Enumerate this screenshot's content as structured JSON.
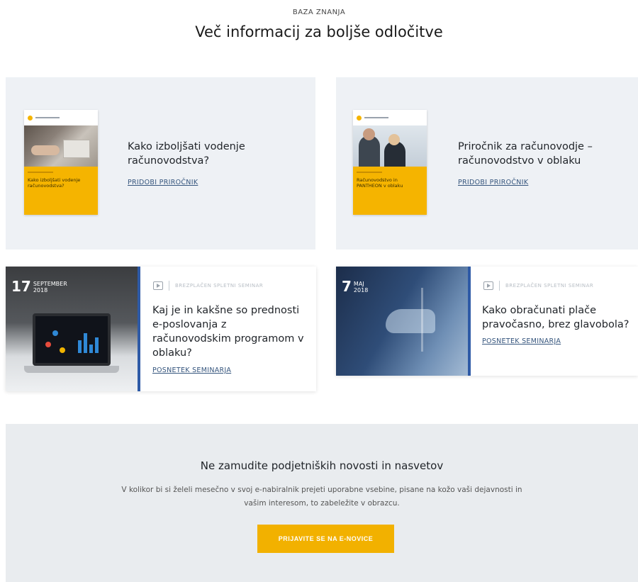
{
  "header": {
    "eyebrow": "BAZA ZNANJA",
    "title": "Več informacij za boljše odločitve"
  },
  "guides": [
    {
      "title": "Kako izboljšati vodenje računovodstva?",
      "link": "PRIDOBI PRIROČNIK",
      "cover_title": "Kako izboljšati vodenje računovodstva?"
    },
    {
      "title": "Priročnik za računovodje – računovodstvo v oblaku",
      "link": "PRIDOBI PRIROČNIK",
      "cover_title": "Računovodstvo in PANTHEON v oblaku"
    }
  ],
  "webinars": [
    {
      "day": "17",
      "month": "SEPTEMBER",
      "year": "2018",
      "type": "BREZPLAČEN SPLETNI SEMINAR",
      "title": "Kaj je in kakšne so prednosti e-poslovanja z računovodskim programom v oblaku?",
      "link": "POSNETEK SEMINARJA"
    },
    {
      "day": "7",
      "month": "MAJ",
      "year": "2018",
      "type": "BREZPLAČEN SPLETNI SEMINAR",
      "title": "Kako obračunati plače pravočasno, brez glavobola?",
      "link": "POSNETEK SEMINARJA"
    }
  ],
  "newsletter": {
    "title": "Ne zamudite podjetniških novosti in nasvetov",
    "text": "V kolikor bi si želeli mesečno v svoj e-nabiralnik prejeti uporabne vsebine, pisane na kožo vaši dejavnosti in vašim interesom, to zabeležite v obrazcu.",
    "button": "PRIJAVITE SE NA E-NOVICE"
  },
  "colors": {
    "accent": "#f2b100",
    "link": "#35557d",
    "card_bg": "#eef1f5",
    "webinar_border": "#2e5aa6"
  }
}
